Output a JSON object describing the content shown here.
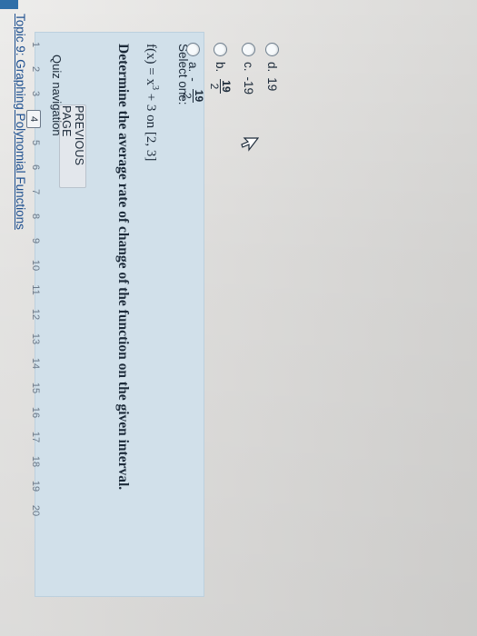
{
  "topic_link": "Topic 9: Graphing Polynomial Functions",
  "question": {
    "text": "Determine the average rate of change of the function on the given interval.",
    "formula_lhs": "f(x) = x",
    "formula_exp": "3",
    "formula_rhs": " + 3 on [2, 3]",
    "select_label": "Select one:",
    "options": [
      {
        "letter": "a.",
        "sign": "-",
        "num": "19",
        "den": "2"
      },
      {
        "letter": "b.",
        "sign": "",
        "num": "19",
        "den": "2"
      },
      {
        "letter": "c.",
        "text": "-19"
      },
      {
        "letter": "d.",
        "text": "19"
      }
    ]
  },
  "previous_page_label": "PREVIOUS PAGE",
  "quiz_navigation": {
    "label": "Quiz navigation",
    "pages": [
      "1",
      "2",
      "3",
      "4",
      "5",
      "6",
      "7",
      "8",
      "9",
      "10",
      "11",
      "12",
      "13",
      "14",
      "15",
      "16",
      "17",
      "18",
      "19",
      "20"
    ],
    "current": "4"
  },
  "colors": {
    "panel": "#d1e0ea",
    "link": "#1d4f8f"
  }
}
